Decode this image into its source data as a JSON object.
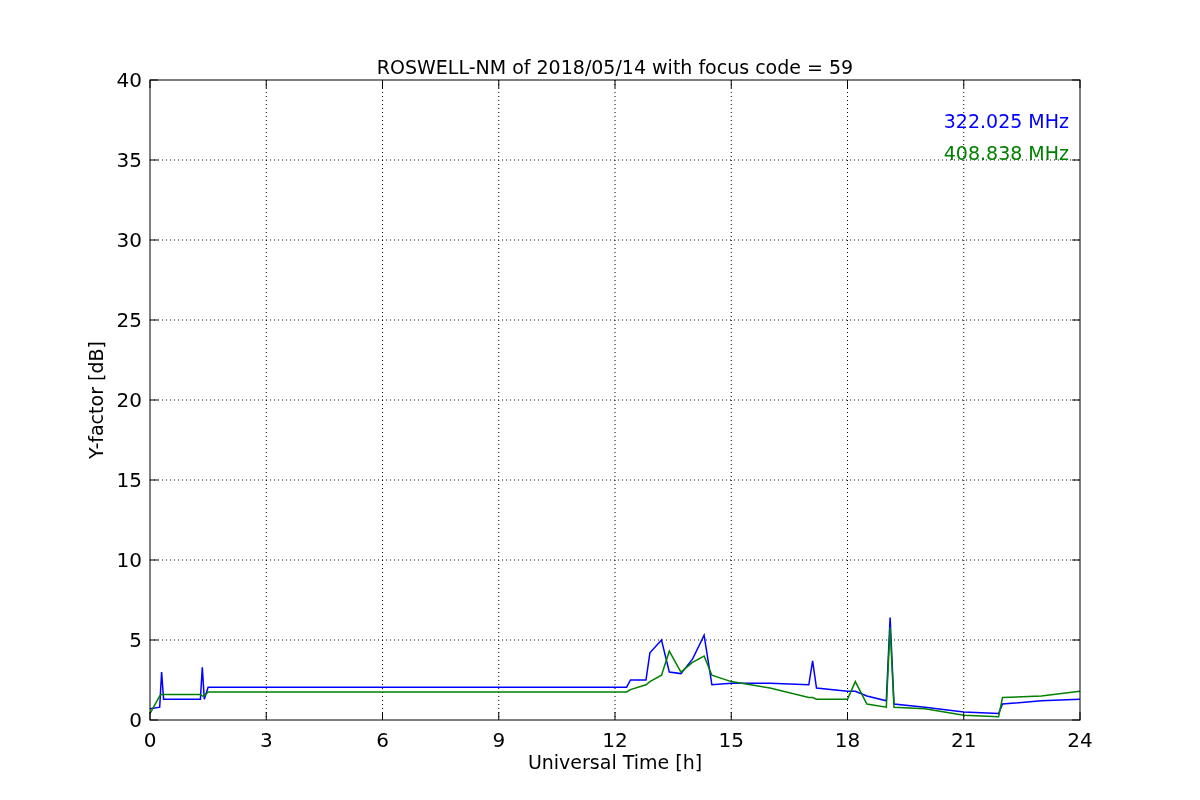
{
  "chart": {
    "chart_data": {
      "type": "line",
      "title": "ROSWELL-NM of 2018/05/14 with focus code = 59",
      "xlabel": "Universal Time [h]",
      "ylabel": "Y-factor [dB]",
      "x": [
        0,
        0.25,
        0.3,
        0.35,
        1.3,
        1.35,
        1.4,
        1.5,
        12.3,
        12.4,
        12.8,
        12.9,
        13.2,
        13.4,
        13.7,
        14,
        14.3,
        14.5,
        15,
        16,
        17,
        17.1,
        17.2,
        18,
        18.2,
        18.5,
        19,
        19.1,
        19.2,
        20,
        21,
        21.9,
        22,
        23,
        24
      ],
      "series": [
        {
          "name": "322.025 MHz",
          "color": "#0000ff",
          "values": [
            0.7,
            0.8,
            3.0,
            1.3,
            1.3,
            3.3,
            1.3,
            2.05,
            2.05,
            2.5,
            2.5,
            4.2,
            5.0,
            3.0,
            2.9,
            3.8,
            5.3,
            2.2,
            2.3,
            2.3,
            2.2,
            3.7,
            2.0,
            1.8,
            1.8,
            1.5,
            1.2,
            6.4,
            1.0,
            0.8,
            0.5,
            0.4,
            1.0,
            1.2,
            1.3
          ]
        },
        {
          "name": "408.838 MHz",
          "color": "#008000",
          "values": [
            0.4,
            1.5,
            1.6,
            1.6,
            1.6,
            1.5,
            1.5,
            1.75,
            1.75,
            1.9,
            2.2,
            2.4,
            2.8,
            4.3,
            3.0,
            3.6,
            4.0,
            2.8,
            2.4,
            2.0,
            1.4,
            1.4,
            1.3,
            1.3,
            2.4,
            1.0,
            0.8,
            5.8,
            0.8,
            0.7,
            0.3,
            0.2,
            1.4,
            1.5,
            1.8
          ]
        }
      ],
      "xlim": [
        0,
        24
      ],
      "ylim": [
        0,
        40
      ],
      "xticks": [
        0,
        3,
        6,
        9,
        12,
        15,
        18,
        21,
        24
      ],
      "yticks": [
        0,
        5,
        10,
        15,
        20,
        25,
        30,
        35,
        40
      ],
      "grid": true
    }
  }
}
